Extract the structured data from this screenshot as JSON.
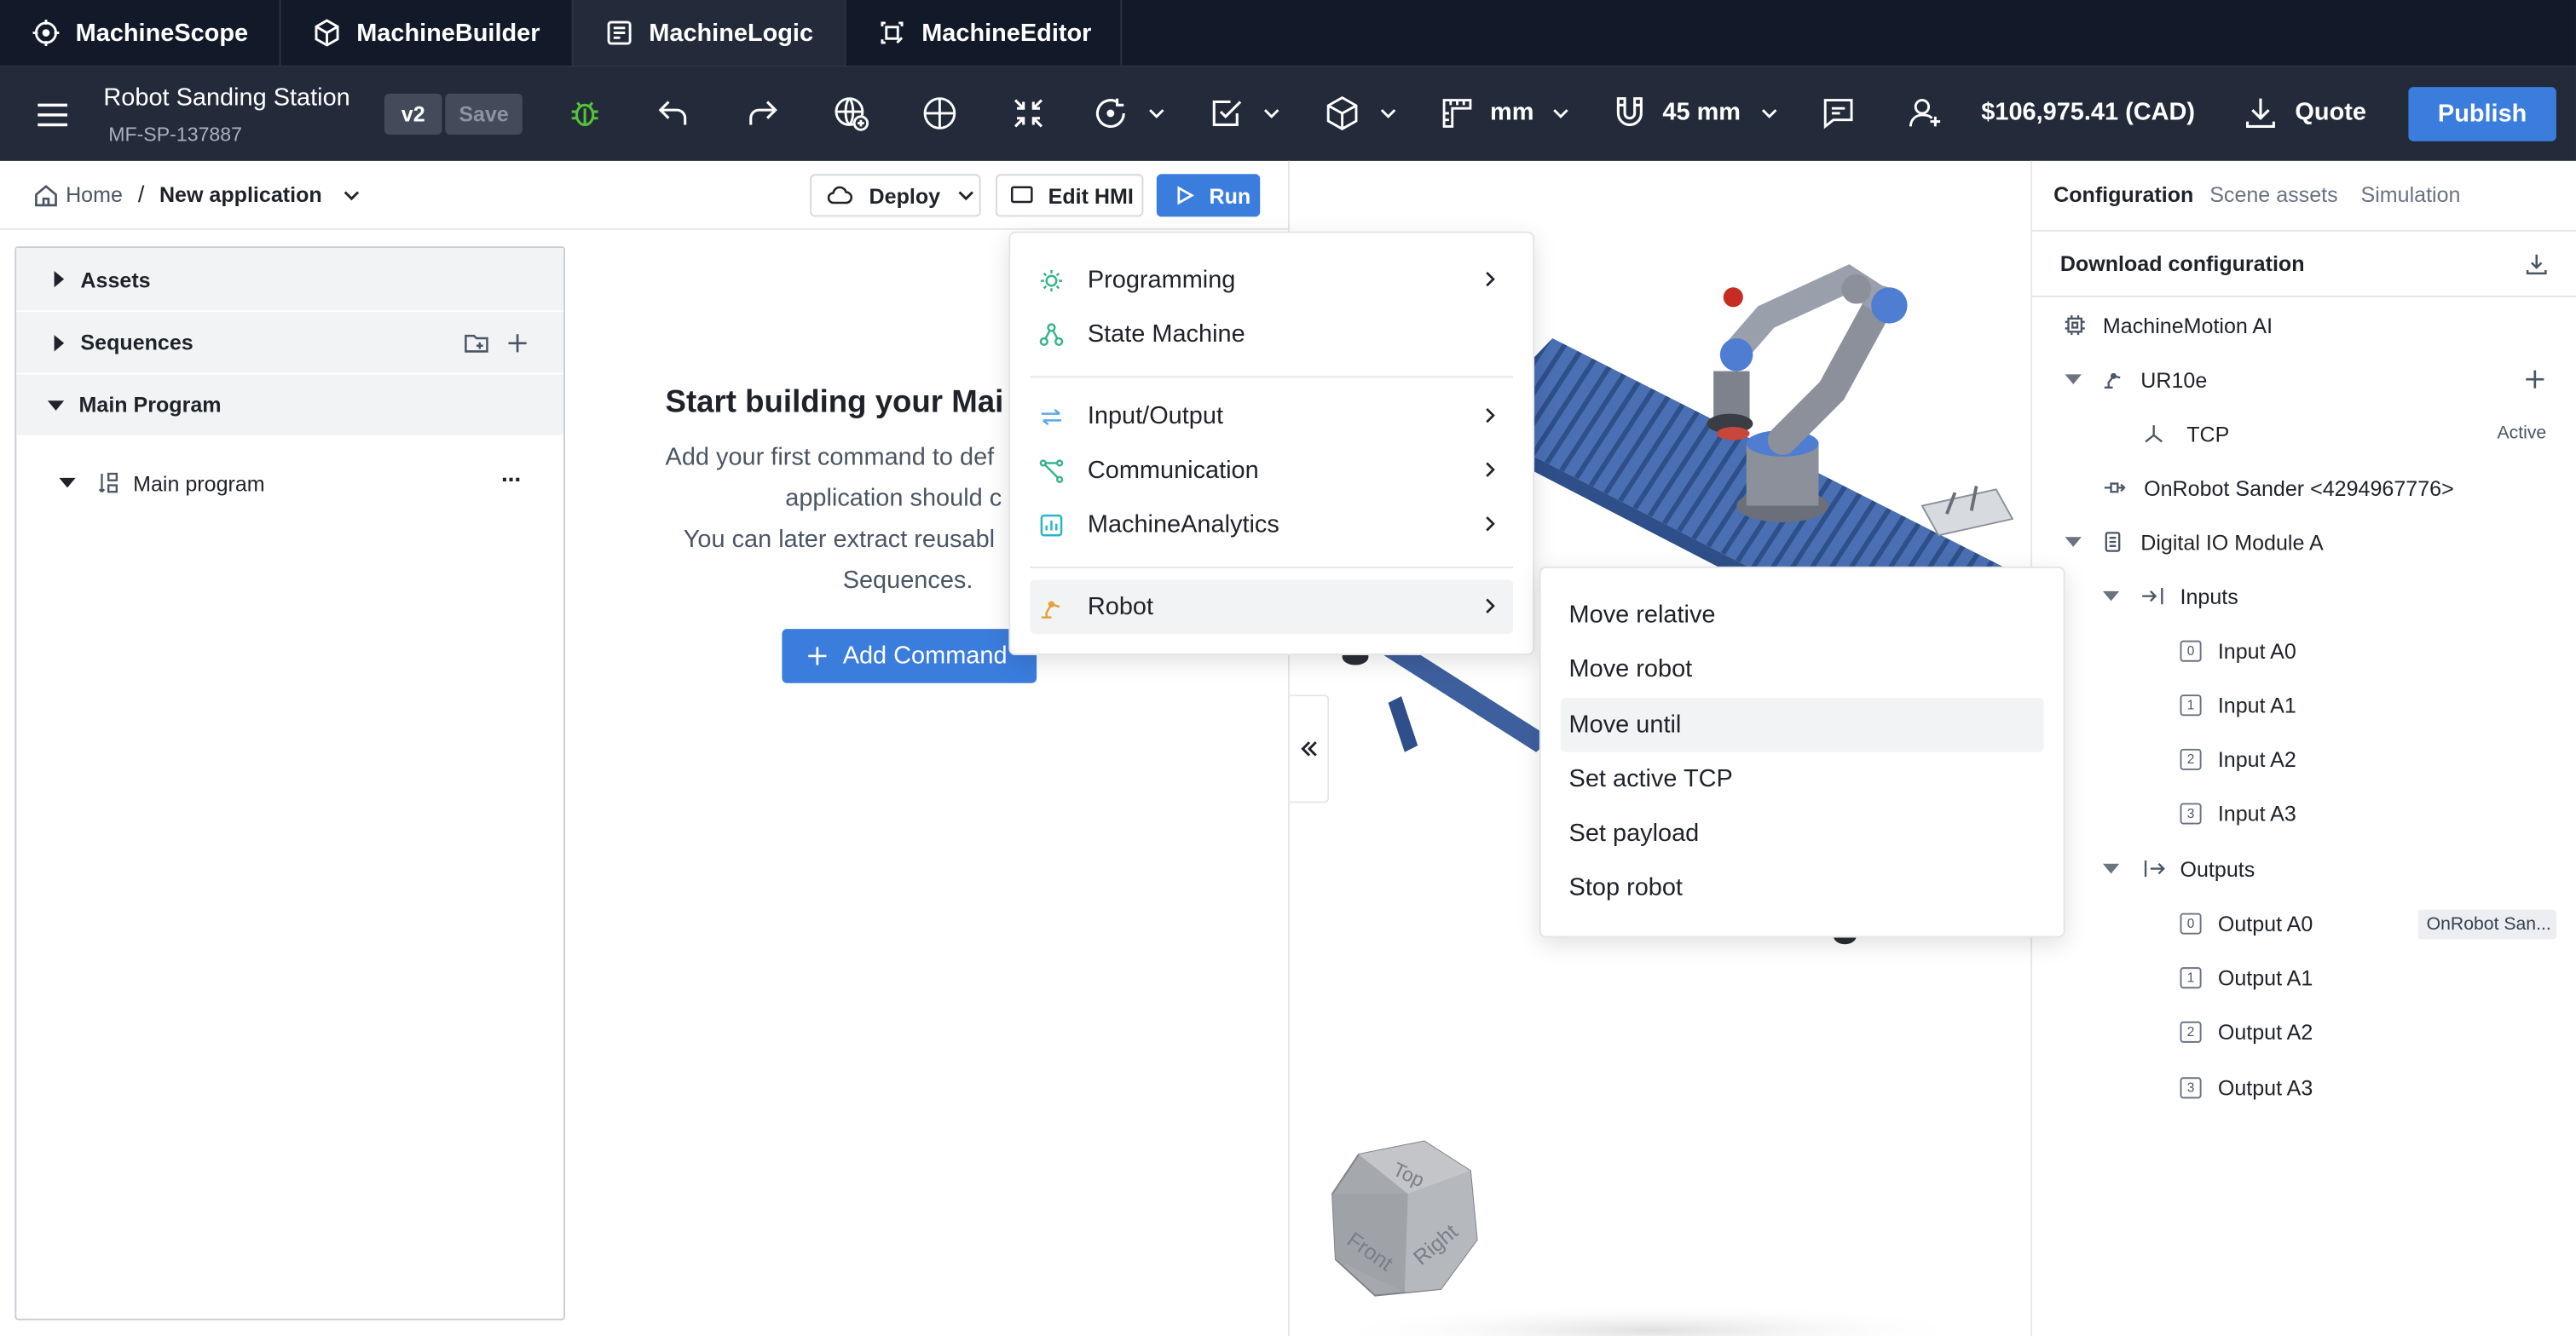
{
  "app_tabs": [
    {
      "label": "MachineScope",
      "icon": "scope-icon"
    },
    {
      "label": "MachineBuilder",
      "icon": "cube-icon"
    },
    {
      "label": "MachineLogic",
      "icon": "logic-icon"
    },
    {
      "label": "MachineEditor",
      "icon": "editor-icon"
    }
  ],
  "toolbar": {
    "project_name": "Robot Sanding Station",
    "project_id": "MF-SP-137887",
    "version": "v2",
    "save_label": "Save",
    "unit": "mm",
    "snap": "45 mm",
    "price": "$106,975.41 (CAD)",
    "quote_label": "Quote",
    "publish_label": "Publish",
    "accent": "#3b7ddd",
    "debug_color": "#55c23a"
  },
  "breadcrumb": {
    "home": "Home",
    "separator": "/",
    "current": "New application"
  },
  "actions": {
    "deploy": "Deploy",
    "edit_hmi": "Edit HMI",
    "run": "Run"
  },
  "left_panel": {
    "assets": "Assets",
    "sequences": "Sequences",
    "main_program": "Main Program",
    "main_program_item": "Main program",
    "more": "···"
  },
  "empty_state": {
    "title": "Start building your Mai",
    "line1": "Add your first command to def",
    "line2": "application should c",
    "line3": "You can later extract reusabl",
    "line4": "Sequences.",
    "add_command": "Add Command"
  },
  "command_menu": {
    "items": [
      {
        "label": "Programming",
        "icon": "programming-icon",
        "submenu": true
      },
      {
        "label": "State Machine",
        "icon": "state-machine-icon",
        "submenu": false
      },
      {
        "label": "Input/Output",
        "icon": "io-icon",
        "submenu": true
      },
      {
        "label": "Communication",
        "icon": "communication-icon",
        "submenu": true
      },
      {
        "label": "MachineAnalytics",
        "icon": "analytics-icon",
        "submenu": true
      },
      {
        "label": "Robot",
        "icon": "robot-icon",
        "submenu": true
      }
    ]
  },
  "robot_submenu": {
    "items": [
      "Move relative",
      "Move robot",
      "Move until",
      "Set active TCP",
      "Set payload",
      "Stop robot"
    ],
    "hovered": "Move until"
  },
  "viewcube": {
    "top": "Top",
    "front": "Front",
    "right": "Right"
  },
  "right_panel": {
    "tabs": [
      "Configuration",
      "Scene assets",
      "Simulation"
    ],
    "download": "Download configuration",
    "tree": {
      "controller": "MachineMotion AI",
      "robot": "UR10e",
      "tcp": "TCP",
      "tcp_status": "Active",
      "sander": "OnRobot Sander <4294967776>",
      "io_module": "Digital IO Module A",
      "inputs_label": "Inputs",
      "inputs": [
        {
          "index": "0",
          "label": "Input A0"
        },
        {
          "index": "1",
          "label": "Input A1"
        },
        {
          "index": "2",
          "label": "Input A2"
        },
        {
          "index": "3",
          "label": "Input A3"
        }
      ],
      "outputs_label": "Outputs",
      "outputs": [
        {
          "index": "0",
          "label": "Output A0",
          "tag": "OnRobot San..."
        },
        {
          "index": "1",
          "label": "Output A1"
        },
        {
          "index": "2",
          "label": "Output A2"
        },
        {
          "index": "3",
          "label": "Output A3"
        }
      ]
    }
  }
}
